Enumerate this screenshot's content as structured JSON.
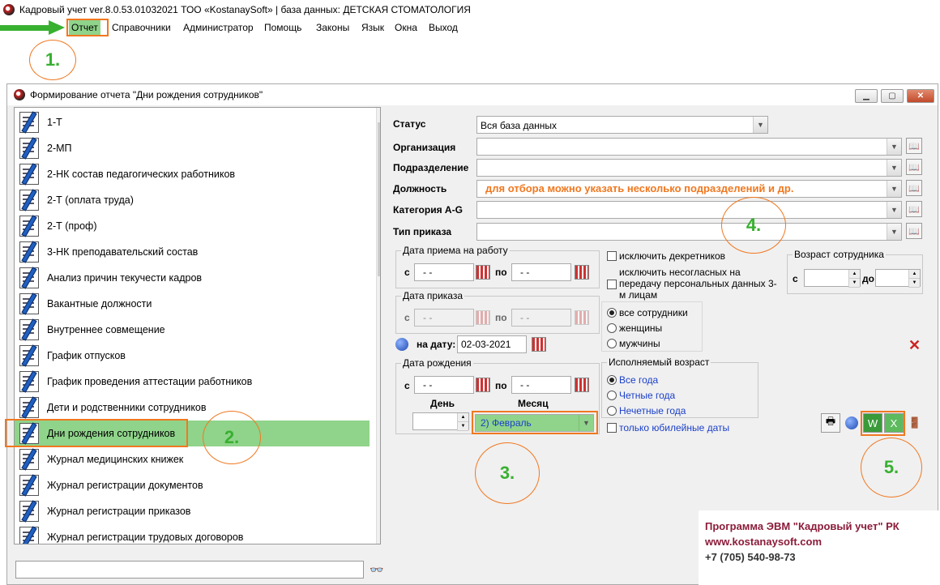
{
  "app": {
    "title": "Кадровый учет ver.8.0.53.01032021 ТОО «KostanaySoft» | база данных: ДЕТСКАЯ СТОМАТОЛОГИЯ"
  },
  "menu": [
    "Отчет",
    "Справочники",
    "Администратор",
    "Помощь",
    "Законы",
    "Язык",
    "Окна",
    "Выход"
  ],
  "annotations": [
    "1.",
    "2.",
    "3.",
    "4.",
    "5."
  ],
  "window": {
    "title": "Формирование отчета \"Дни рождения сотрудников\""
  },
  "reports": [
    "1-Т",
    "2-МП",
    "2-НК состав педагогических работников",
    "2-Т (оплата труда)",
    "2-Т (проф)",
    "3-НК преподавательский состав",
    "Анализ причин текучести кадров",
    "Вакантные должности",
    "Внутреннее совмещение",
    "График отпусков",
    "График проведения аттестации работников",
    "Дети и родственники сотрудников",
    "Дни рождения сотрудников",
    "Журнал медицинских книжек",
    "Журнал регистрации документов",
    "Журнал регистрации приказов",
    "Журнал регистрации трудовых договоров"
  ],
  "selected_report_index": 12,
  "filters": {
    "status_label": "Статус",
    "status_value": "Вся база данных",
    "org_label": "Организация",
    "dept_label": "Подразделение",
    "position_label": "Должность",
    "category_label": "Категория A-G",
    "order_type_label": "Тип приказа",
    "hint": "для отбора можно указать несколько подразделений и др."
  },
  "hire_date": {
    "title": "Дата приема на работу",
    "from_label": "с",
    "to_label": "по",
    "from": "- -",
    "to": "- -"
  },
  "order_date": {
    "title": "Дата приказа",
    "from_label": "с",
    "to_label": "по",
    "from": "- -",
    "to": "- -"
  },
  "on_date": {
    "label": "на дату:",
    "value": "02-03-2021"
  },
  "birth_date": {
    "title": "Дата рождения",
    "from_label": "с",
    "to_label": "по",
    "from": "- -",
    "to": "- -",
    "day_label": "День",
    "month_label": "Месяц",
    "month_value": "2) Февраль"
  },
  "checks": {
    "excl_maternity": "исключить декретников",
    "excl_nonconsent": "исключить несогласных на передачу персональных данных 3-м лицам",
    "jubilee": "только юбилейные даты"
  },
  "gender": {
    "options": [
      "все сотрудники",
      "женщины",
      "мужчины"
    ],
    "selected": 0
  },
  "age_group": {
    "title": "Исполняемый возраст",
    "options": [
      "Все года",
      "Четные года",
      "Нечетные года"
    ],
    "selected": 0
  },
  "employee_age": {
    "title": "Возраст сотрудника",
    "from_label": "с",
    "to_label": "до"
  },
  "promo": {
    "line1": "Программа ЭВМ \"Кадровый учет\" РК",
    "line2": "www.kostanaysoft.com",
    "line3": "+7 (705) 540-98-73"
  },
  "colors": {
    "accent": "#f07820",
    "green": "#38b030",
    "hint": "#f07820",
    "link": "#1a3fc8",
    "promo": "#8b1c3a"
  }
}
